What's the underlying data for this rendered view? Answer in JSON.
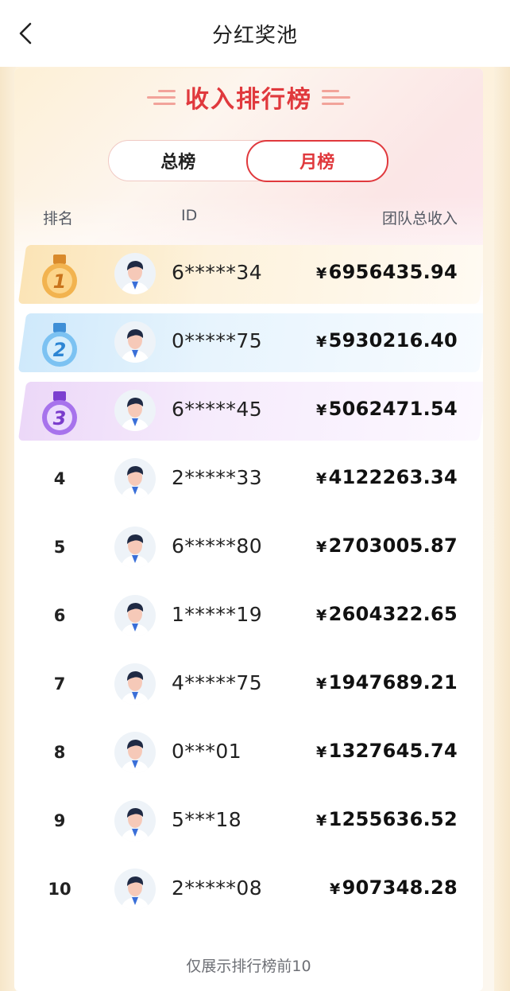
{
  "header": {
    "title": "分红奖池"
  },
  "board": {
    "title": "收入排行榜",
    "tabs": [
      {
        "label": "总榜",
        "active": false
      },
      {
        "label": "月榜",
        "active": true
      }
    ],
    "columns": {
      "rank": "排名",
      "id": "ID",
      "income": "团队总收入"
    },
    "currency_symbol": "¥",
    "rows": [
      {
        "rank": "1",
        "id": "6*****34",
        "income": "6956435.94",
        "badge": "gold-medal"
      },
      {
        "rank": "2",
        "id": "0*****75",
        "income": "5930216.40",
        "badge": "silver-medal"
      },
      {
        "rank": "3",
        "id": "6*****45",
        "income": "5062471.54",
        "badge": "purple-medal"
      },
      {
        "rank": "4",
        "id": "2*****33",
        "income": "4122263.34"
      },
      {
        "rank": "5",
        "id": "6*****80",
        "income": "2703005.87"
      },
      {
        "rank": "6",
        "id": "1*****19",
        "income": "2604322.65"
      },
      {
        "rank": "7",
        "id": "4*****75",
        "income": "1947689.21"
      },
      {
        "rank": "8",
        "id": "0***01",
        "income": "1327645.74"
      },
      {
        "rank": "9",
        "id": "5***18",
        "income": "1255636.52"
      },
      {
        "rank": "10",
        "id": "2*****08",
        "income": "907348.28"
      }
    ],
    "footnote": "仅展示排行榜前10"
  },
  "colors": {
    "accent": "#e0393d",
    "gold": "#e8a23c",
    "silver": "#5aa9e6",
    "purple": "#9b5ee0"
  }
}
